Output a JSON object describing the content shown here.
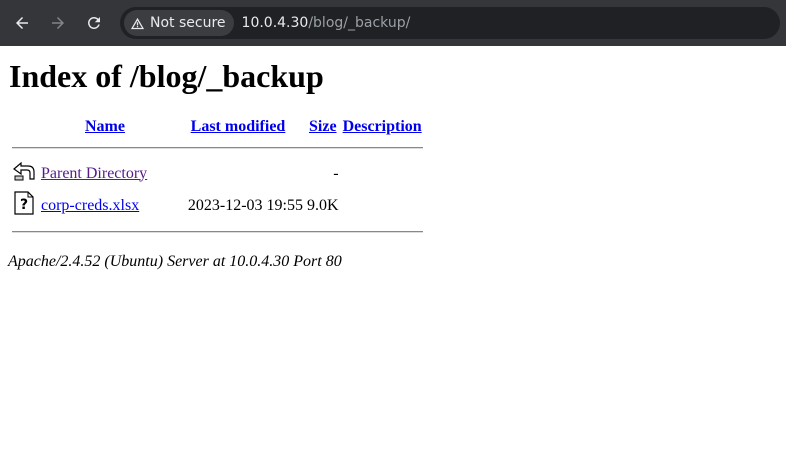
{
  "browser": {
    "security_label": "Not secure",
    "url_host": "10.0.4.30",
    "url_path": "/blog/_backup/"
  },
  "page": {
    "title": "Index of /blog/_backup",
    "columns": {
      "name": "Name",
      "last_modified": "Last modified",
      "size": "Size",
      "description": "Description"
    },
    "rows": [
      {
        "name": "Parent Directory",
        "modified": "",
        "size": "-",
        "description": "",
        "icon": "back-folder-icon"
      },
      {
        "name": "corp-creds.xlsx",
        "modified": "2023-12-03 19:55",
        "size": "9.0K",
        "description": "",
        "icon": "unknown-file-icon"
      }
    ],
    "footer": "Apache/2.4.52 (Ubuntu) Server at 10.0.4.30 Port 80"
  }
}
